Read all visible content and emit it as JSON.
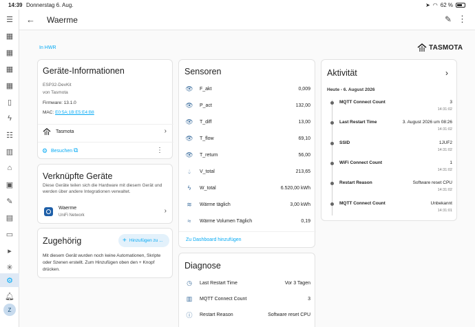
{
  "statusbar": {
    "time": "14:39",
    "date": "Donnerstag 6. Aug.",
    "battery": "62 %"
  },
  "header": {
    "title": "Waerme"
  },
  "breadcrumb": "In HWR",
  "logo": {
    "text": "TASMOTA"
  },
  "device_info": {
    "title": "Geräte-Informationen",
    "model": "ESP32-DevKit",
    "manufacturer": "von Tasmota",
    "firmware": "Firmware: 13.1.0",
    "mac_label": "MAC:",
    "mac_value": "E0:5A:1B:E5:E4:B8",
    "integration": "Tasmota",
    "visit_label": "Besuchen"
  },
  "linked": {
    "title": "Verknüpfte Geräte",
    "description": "Diese Geräte teilen sich die Hardware mit diesem Gerät und werden über andere Integrationen verwaltet.",
    "device_name": "Waerme",
    "device_network": "UniFi Network"
  },
  "related": {
    "title": "Zugehörig",
    "add_label": "Hinzufügen zu ...",
    "description": "Mit diesem Gerät wurden noch keine Automationen, Skripte oder Szenen erstellt. Zum Hinzufügen oben den + Knopf drücken."
  },
  "sensors": {
    "title": "Sensoren",
    "rows": [
      {
        "name": "F_akt",
        "value": "0,009",
        "icon": "eye-icon"
      },
      {
        "name": "P_act",
        "value": "132,00",
        "icon": "eye-icon"
      },
      {
        "name": "T_diff",
        "value": "13,00",
        "icon": "eye-icon"
      },
      {
        "name": "T_flow",
        "value": "69,10",
        "icon": "eye-icon"
      },
      {
        "name": "T_return",
        "value": "56,00",
        "icon": "eye-icon"
      },
      {
        "name": "V_total",
        "value": "213,65",
        "icon": "water-drop-icon"
      },
      {
        "name": "W_total",
        "value": "6.520,00 kWh",
        "icon": "lightning-icon"
      },
      {
        "name": "Wärme täglich",
        "value": "3,00 kWh",
        "icon": "heat-waves-icon"
      },
      {
        "name": "Wärme Volumen Täglich",
        "value": "0,19",
        "icon": "water-waves-icon"
      }
    ],
    "add_dashboard": "Zu Dashboard hinzufügen"
  },
  "diagnose": {
    "title": "Diagnose",
    "rows": [
      {
        "name": "Last Restart Time",
        "value": "Vor 3 Tagen",
        "icon": "clock-icon"
      },
      {
        "name": "MQTT Connect Count",
        "value": "3",
        "icon": "counter-icon"
      },
      {
        "name": "Restart Reason",
        "value": "Software reset CPU",
        "icon": "info-icon"
      }
    ]
  },
  "activity": {
    "title": "Aktivität",
    "date_header": "Heute - 6. August 2026",
    "items": [
      {
        "name": "MQTT Connect Count",
        "value": "3",
        "time": "14:31:02"
      },
      {
        "name": "Last Restart Time",
        "value": "3. August 2026 um 08:26",
        "time": "14:31:02"
      },
      {
        "name": "SSID",
        "value": "1JUF2",
        "time": "14:31:02"
      },
      {
        "name": "WiFi Connect Count",
        "value": "1",
        "time": "14:31:02"
      },
      {
        "name": "Restart Reason",
        "value": "Software reset CPU",
        "time": "14:31:02"
      },
      {
        "name": "MQTT Connect Count",
        "value": "Unbekannt",
        "time": "14:31:01"
      }
    ]
  },
  "sidebar": {
    "avatar": "Z"
  },
  "colors": {
    "accent": "#03a9f4",
    "icon": "#3c6e9e"
  }
}
